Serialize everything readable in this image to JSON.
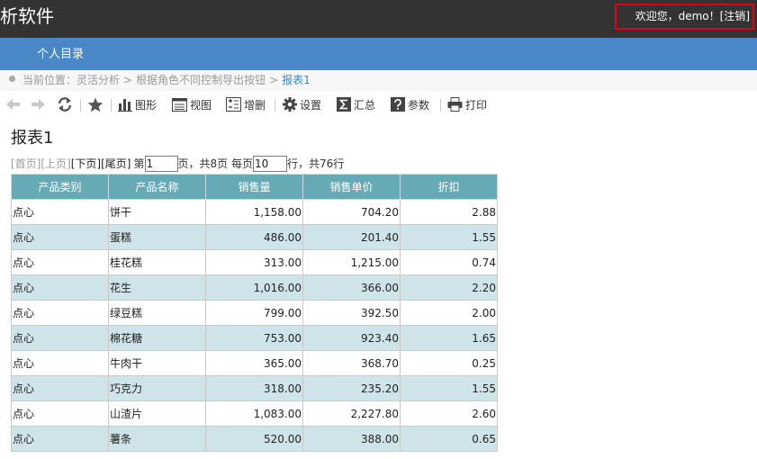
{
  "header": {
    "app_title": "析软件",
    "welcome": "欢迎您，demo！[",
    "logout": "注销",
    "welcome_end": "]"
  },
  "nav": {
    "items": [
      "个人目录"
    ]
  },
  "breadcrumb": {
    "prefix": "当前位置：",
    "items": [
      "灵活分析",
      "根据角色不同控制导出按钮",
      "报表1"
    ],
    "separator": ">"
  },
  "toolbar": {
    "back_icon": "arrow-left-icon",
    "forward_icon": "arrow-right-icon",
    "refresh_icon": "refresh-icon",
    "favorite_icon": "star-icon",
    "chart_label": "图形",
    "view_label": "视图",
    "edit_label": "增删",
    "settings_label": "设置",
    "sum_label": "汇总",
    "params_label": "参数",
    "print_label": "打印"
  },
  "report": {
    "title": "报表1"
  },
  "pager": {
    "first": "[首页]",
    "prev": "[上页]",
    "next": "[下页]",
    "last": "[尾页]",
    "page_prefix": "第",
    "current_page": "1",
    "page_suffix": "页，共8页 每页",
    "page_size": "10",
    "rows_suffix": "行，共76行"
  },
  "table": {
    "columns": [
      "产品类别",
      "产品名称",
      "销售量",
      "销售单价",
      "折扣"
    ],
    "rows": [
      [
        "点心",
        "饼干",
        "1,158.00",
        "704.20",
        "2.88"
      ],
      [
        "点心",
        "蛋糕",
        "486.00",
        "201.40",
        "1.55"
      ],
      [
        "点心",
        "桂花糕",
        "313.00",
        "1,215.00",
        "0.74"
      ],
      [
        "点心",
        "花生",
        "1,016.00",
        "366.00",
        "2.20"
      ],
      [
        "点心",
        "绿豆糕",
        "799.00",
        "392.50",
        "2.00"
      ],
      [
        "点心",
        "棉花糖",
        "753.00",
        "923.40",
        "1.65"
      ],
      [
        "点心",
        "牛肉干",
        "365.00",
        "368.70",
        "0.25"
      ],
      [
        "点心",
        "巧克力",
        "318.00",
        "235.20",
        "1.55"
      ],
      [
        "点心",
        "山渣片",
        "1,083.00",
        "2,227.80",
        "2.60"
      ],
      [
        "点心",
        "薯条",
        "520.00",
        "388.00",
        "0.65"
      ]
    ]
  },
  "colors": {
    "topbar": "#333333",
    "navbar": "#4a87c8",
    "table_header": "#66aab6",
    "alt_row": "#cfe4e8",
    "highlight_border": "#e60012"
  }
}
